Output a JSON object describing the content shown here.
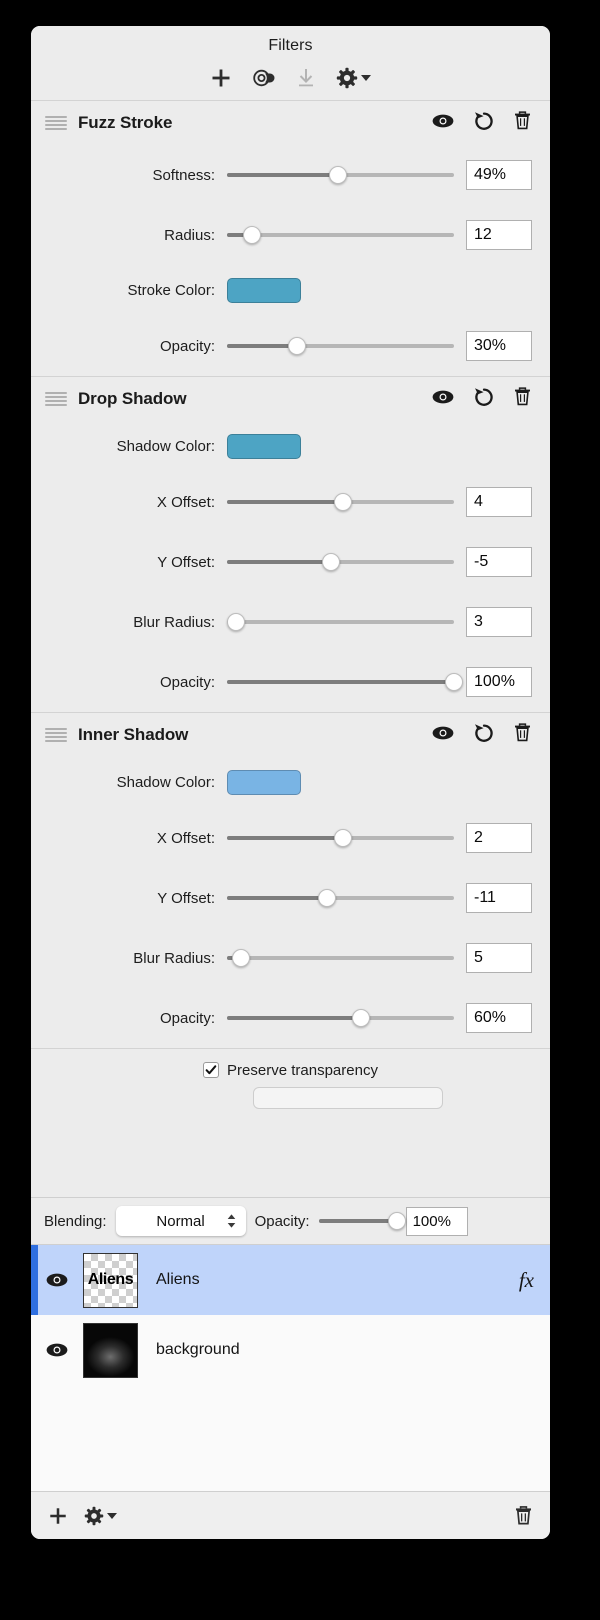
{
  "panel": {
    "title": "Filters",
    "toolbar": [
      {
        "name": "add-filter-button",
        "icon": "plus-icon",
        "disabled": false
      },
      {
        "name": "preset-button",
        "icon": "preset-disc-icon",
        "disabled": false
      },
      {
        "name": "download-button",
        "icon": "download-icon",
        "disabled": true
      },
      {
        "name": "settings-menu-button",
        "icon": "gear-icon",
        "disabled": false
      }
    ]
  },
  "sections": [
    {
      "name": "Fuzz Stroke",
      "rows": [
        {
          "label": "Softness:",
          "type": "slider",
          "value": "49%",
          "pct": 49
        },
        {
          "label": "Radius:",
          "type": "slider",
          "value": "12",
          "pct": 11
        },
        {
          "label": "Stroke Color:",
          "type": "color",
          "color": "#4da4c4"
        },
        {
          "label": "Opacity:",
          "type": "slider",
          "value": "30%",
          "pct": 31
        }
      ]
    },
    {
      "name": "Drop Shadow",
      "rows": [
        {
          "label": "Shadow Color:",
          "type": "color",
          "color": "#4da4c4"
        },
        {
          "label": "X Offset:",
          "type": "slider",
          "value": "4",
          "pct": 51
        },
        {
          "label": "Y Offset:",
          "type": "slider",
          "value": "-5",
          "pct": 46
        },
        {
          "label": "Blur Radius:",
          "type": "slider",
          "value": "3",
          "pct": 4
        },
        {
          "label": "Opacity:",
          "type": "slider",
          "value": "100%",
          "pct": 100
        }
      ]
    },
    {
      "name": "Inner Shadow",
      "rows": [
        {
          "label": "Shadow Color:",
          "type": "color",
          "color": "#79b4e4"
        },
        {
          "label": "X Offset:",
          "type": "slider",
          "value": "2",
          "pct": 51
        },
        {
          "label": "Y Offset:",
          "type": "slider",
          "value": "-11",
          "pct": 44
        },
        {
          "label": "Blur Radius:",
          "type": "slider",
          "value": "5",
          "pct": 6
        },
        {
          "label": "Opacity:",
          "type": "slider",
          "value": "60%",
          "pct": 59
        }
      ]
    }
  ],
  "section_icons": {
    "visibility": "eye-icon",
    "reset": "reset-icon",
    "delete": "trash-icon"
  },
  "preserve": {
    "label": "Preserve transparency",
    "checked": true,
    "check_glyph": "✓"
  },
  "blending": {
    "label": "Blending:",
    "value": "Normal",
    "options": [
      "Normal"
    ],
    "opacity_label": "Opacity:",
    "opacity_value": "100%",
    "opacity_pct": 100
  },
  "layers": [
    {
      "name": "Aliens",
      "thumb_text": "Aliens",
      "thumb_type": "transparent",
      "selected": true,
      "visible": true,
      "fx": "fx"
    },
    {
      "name": "background",
      "thumb_text": "",
      "thumb_type": "dark",
      "selected": false,
      "visible": true,
      "fx": ""
    }
  ],
  "bottom_bar": [
    {
      "name": "add-layer-button",
      "icon": "plus-icon"
    },
    {
      "name": "layer-settings-menu-button",
      "icon": "gear-icon"
    },
    {
      "name": "delete-layer-button",
      "icon": "trash-icon"
    }
  ],
  "colors": {
    "selection": "#bfd4fa",
    "selection_bar": "#2f6fe0",
    "panel_bg": "#ececec",
    "list_bg": "#fafafa"
  }
}
